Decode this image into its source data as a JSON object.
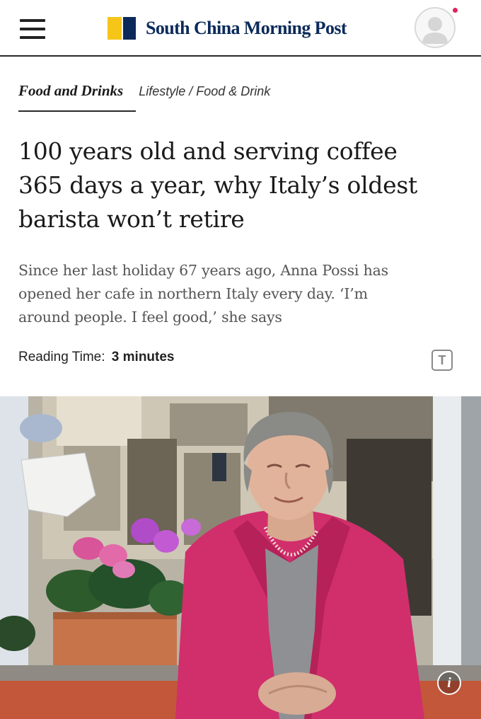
{
  "header": {
    "logo_text": "South China Morning Post",
    "menu_icon": "hamburger-menu-icon",
    "account_icon": "user-avatar-icon",
    "colors": {
      "brand_navy": "#0b2a5a",
      "brand_yellow": "#f5c518",
      "notification": "#e0245e"
    }
  },
  "section_nav": {
    "primary": "Food and Drinks",
    "secondary": "Lifestyle / Food & Drink"
  },
  "article": {
    "headline_lines": [
      "100 years old and serving coffee",
      "365 days a year, why Italy’s oldest",
      "barista won’t retire"
    ],
    "summary_lines": [
      "Since her last holiday 67 years ago, Anna Possi has",
      "opened her cafe in northern Italy every day. ‘I’m",
      "around people. I feel good,’ she says"
    ],
    "reading_time_label": "Reading Time:",
    "reading_time_value": "3 minutes",
    "text_size_button": "T",
    "text_size_icon": "text-size-icon"
  },
  "hero": {
    "info_button": "i",
    "info_icon": "info-icon"
  }
}
